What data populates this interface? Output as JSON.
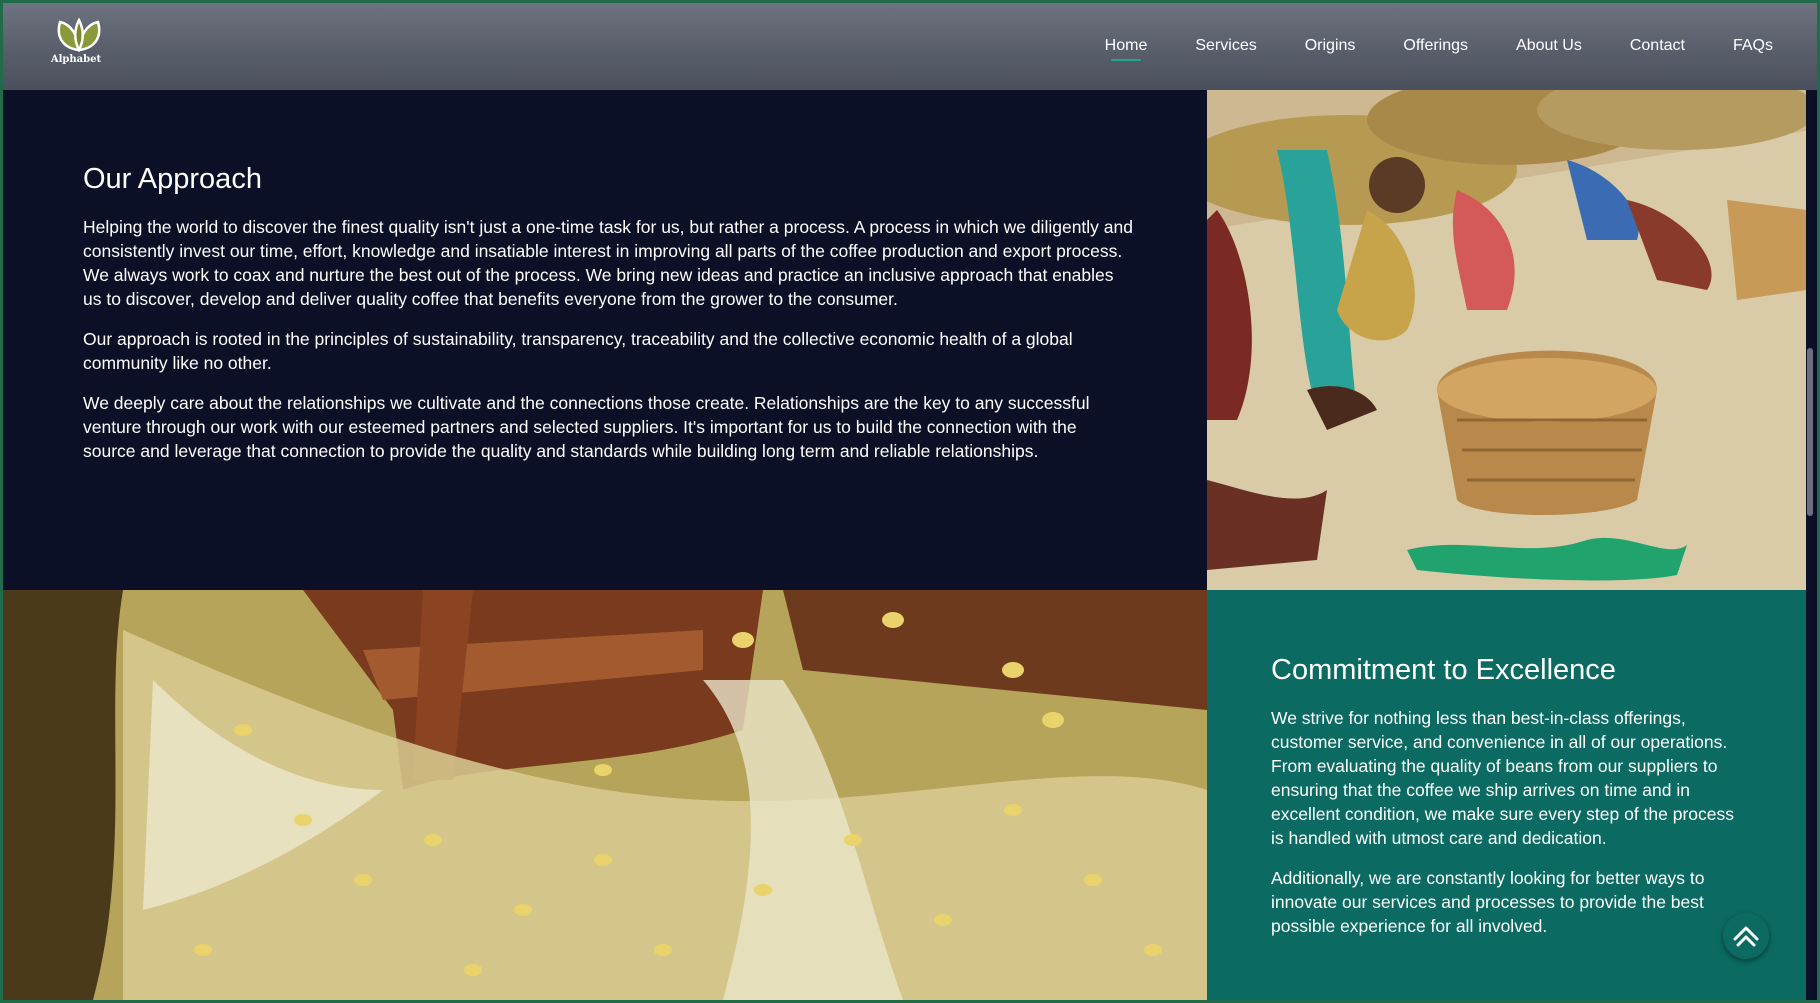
{
  "brand": {
    "name": "Alphabet",
    "logo_icon": "leaf-logo-icon"
  },
  "nav": {
    "items": [
      {
        "label": "Home",
        "active": true
      },
      {
        "label": "Services",
        "active": false
      },
      {
        "label": "Origins",
        "active": false
      },
      {
        "label": "Offerings",
        "active": false
      },
      {
        "label": "About Us",
        "active": false
      },
      {
        "label": "Contact",
        "active": false
      },
      {
        "label": "FAQs",
        "active": false
      }
    ]
  },
  "approach": {
    "title": "Our Approach",
    "paragraphs": [
      "Helping the world to discover the finest quality isn't just a one-time task for us, but rather a process. A process in which we diligently and consistently invest our time, effort, knowledge and insatiable interest in improving all parts of the coffee production and export process. We always work to coax and nurture the best out of the process. We bring new ideas and practice an inclusive approach that enables us to discover, develop and deliver quality coffee that benefits everyone from the grower to the consumer.",
      "Our approach is rooted in the principles of sustainability, transparency, traceability and the collective economic health of a global community like no other.",
      "We deeply care about the relationships we cultivate and the connections those create. Relationships are the key to any successful venture through our work with our esteemed partners and selected suppliers. It's important for us to build the connection with the source and leverage that connection to provide the quality and standards while building long term and reliable relationships."
    ]
  },
  "excellence": {
    "title": "Commitment to Excellence",
    "paragraphs": [
      "We strive for nothing less than best-in-class offerings, customer service, and convenience in all of our operations. From evaluating the quality of beans from our suppliers to ensuring that the coffee we ship arrives on time and in excellent condition, we make sure every step of the process is handled with utmost care and dedication.",
      "Additionally, we are constantly looking for better ways to innovate our services and processes to provide the best possible experience for all involved."
    ]
  },
  "images": {
    "workers": "photo-coffee-sorting-workers",
    "water": "photo-coffee-beans-water-channel"
  },
  "colors": {
    "header": "#5d626f",
    "navy_panel": "#0b1026",
    "teal_panel": "#0b6b62",
    "accent": "#1fa88e"
  },
  "back_to_top_icon": "chevron-up-icon"
}
